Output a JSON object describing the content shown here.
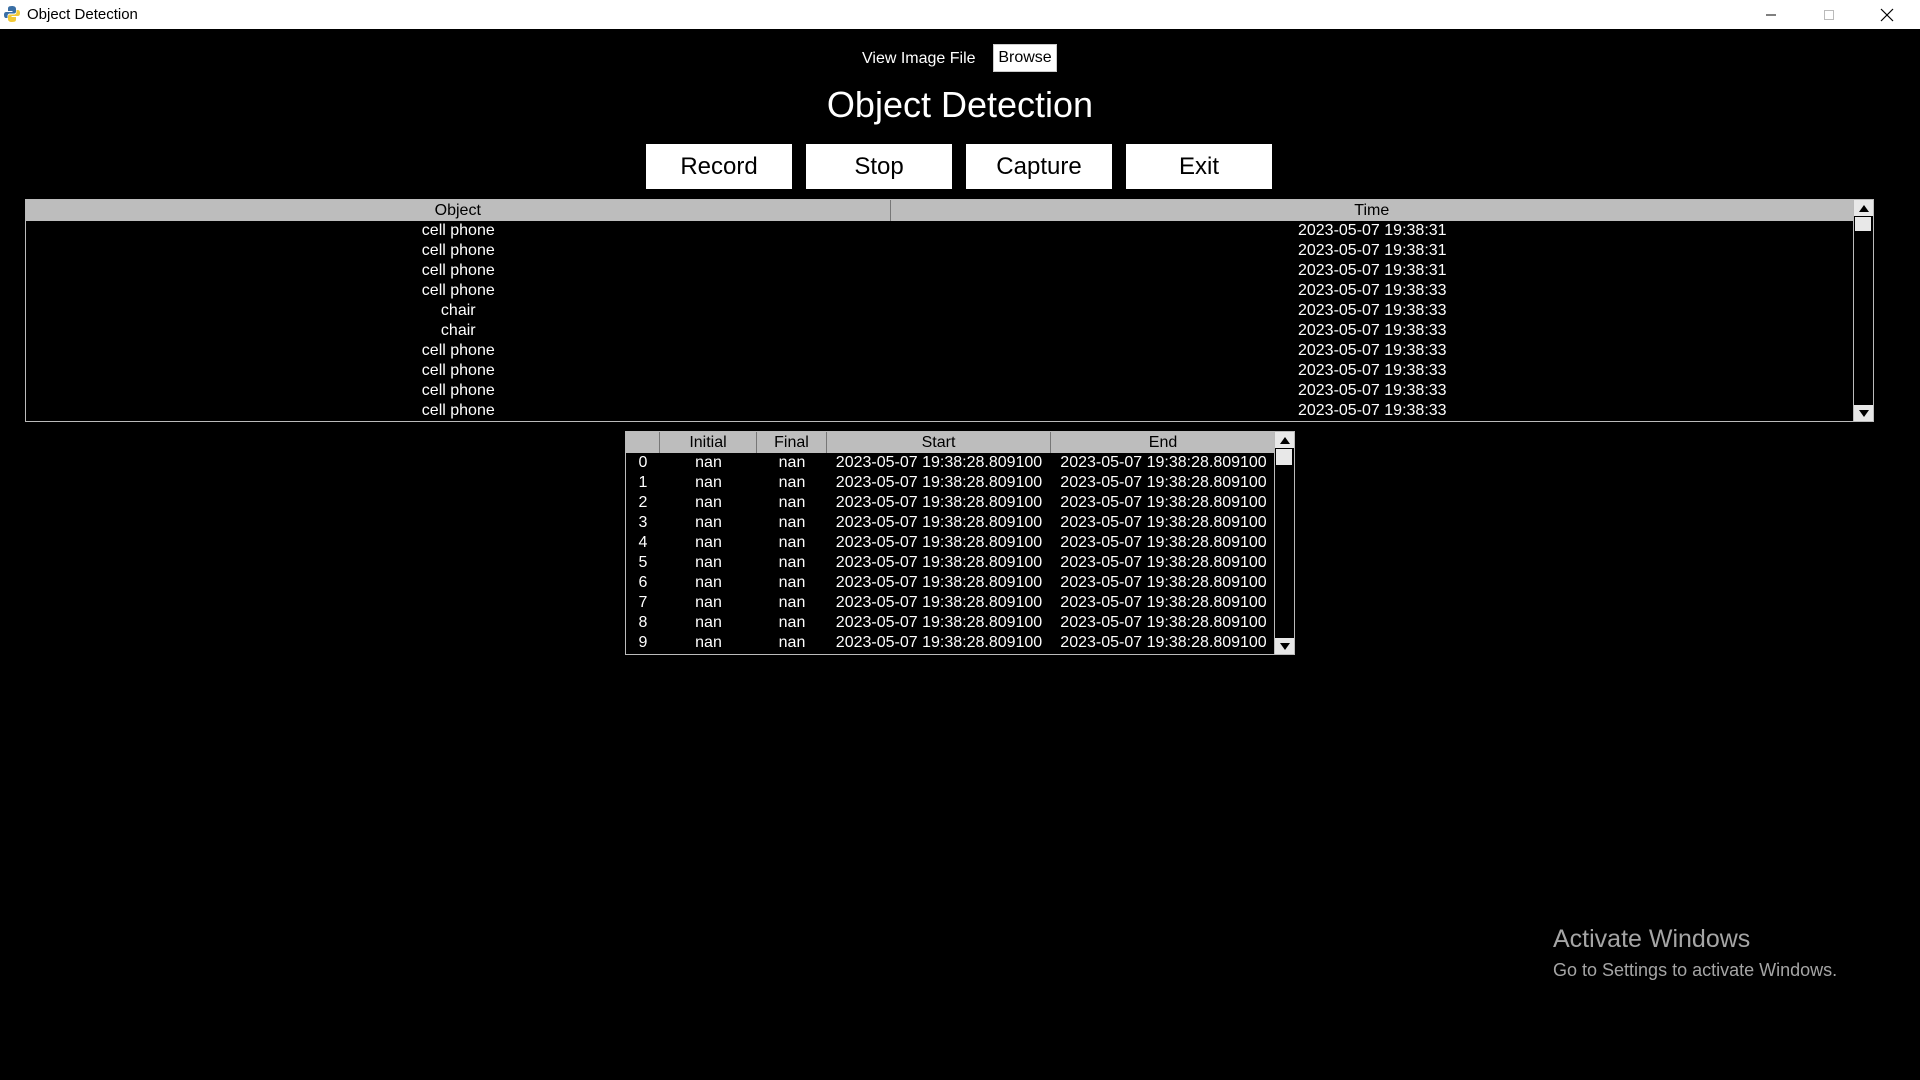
{
  "window": {
    "title": "Object Detection",
    "app_icon": "python-icon",
    "controls": [
      "minimize-icon",
      "maximize-icon",
      "close-icon"
    ]
  },
  "top": {
    "view_image_label": "View Image File",
    "browse_label": "Browse",
    "heading": "Object Detection"
  },
  "buttons": {
    "record": "Record",
    "stop": "Stop",
    "capture": "Capture",
    "exit": "Exit"
  },
  "detections_table": {
    "columns": [
      "Object",
      "Time"
    ],
    "rows": [
      [
        "cell phone",
        "2023-05-07 19:38:31"
      ],
      [
        "cell phone",
        "2023-05-07 19:38:31"
      ],
      [
        "cell phone",
        "2023-05-07 19:38:31"
      ],
      [
        "cell phone",
        "2023-05-07 19:38:33"
      ],
      [
        "chair",
        "2023-05-07 19:38:33"
      ],
      [
        "chair",
        "2023-05-07 19:38:33"
      ],
      [
        "cell phone",
        "2023-05-07 19:38:33"
      ],
      [
        "cell phone",
        "2023-05-07 19:38:33"
      ],
      [
        "cell phone",
        "2023-05-07 19:38:33"
      ],
      [
        "cell phone",
        "2023-05-07 19:38:33"
      ]
    ]
  },
  "motion_table": {
    "columns": [
      "",
      "Initial",
      "Final",
      "Start",
      "End"
    ],
    "rows": [
      [
        "0",
        "nan",
        "nan",
        "2023-05-07 19:38:28.809100",
        "2023-05-07 19:38:28.809100"
      ],
      [
        "1",
        "nan",
        "nan",
        "2023-05-07 19:38:28.809100",
        "2023-05-07 19:38:28.809100"
      ],
      [
        "2",
        "nan",
        "nan",
        "2023-05-07 19:38:28.809100",
        "2023-05-07 19:38:28.809100"
      ],
      [
        "3",
        "nan",
        "nan",
        "2023-05-07 19:38:28.809100",
        "2023-05-07 19:38:28.809100"
      ],
      [
        "4",
        "nan",
        "nan",
        "2023-05-07 19:38:28.809100",
        "2023-05-07 19:38:28.809100"
      ],
      [
        "5",
        "nan",
        "nan",
        "2023-05-07 19:38:28.809100",
        "2023-05-07 19:38:28.809100"
      ],
      [
        "6",
        "nan",
        "nan",
        "2023-05-07 19:38:28.809100",
        "2023-05-07 19:38:28.809100"
      ],
      [
        "7",
        "nan",
        "nan",
        "2023-05-07 19:38:28.809100",
        "2023-05-07 19:38:28.809100"
      ],
      [
        "8",
        "nan",
        "nan",
        "2023-05-07 19:38:28.809100",
        "2023-05-07 19:38:28.809100"
      ],
      [
        "9",
        "nan",
        "nan",
        "2023-05-07 19:38:28.809100",
        "2023-05-07 19:38:28.809100"
      ]
    ]
  },
  "watermark": {
    "line1": "Activate Windows",
    "line2": "Go to Settings to activate Windows."
  }
}
